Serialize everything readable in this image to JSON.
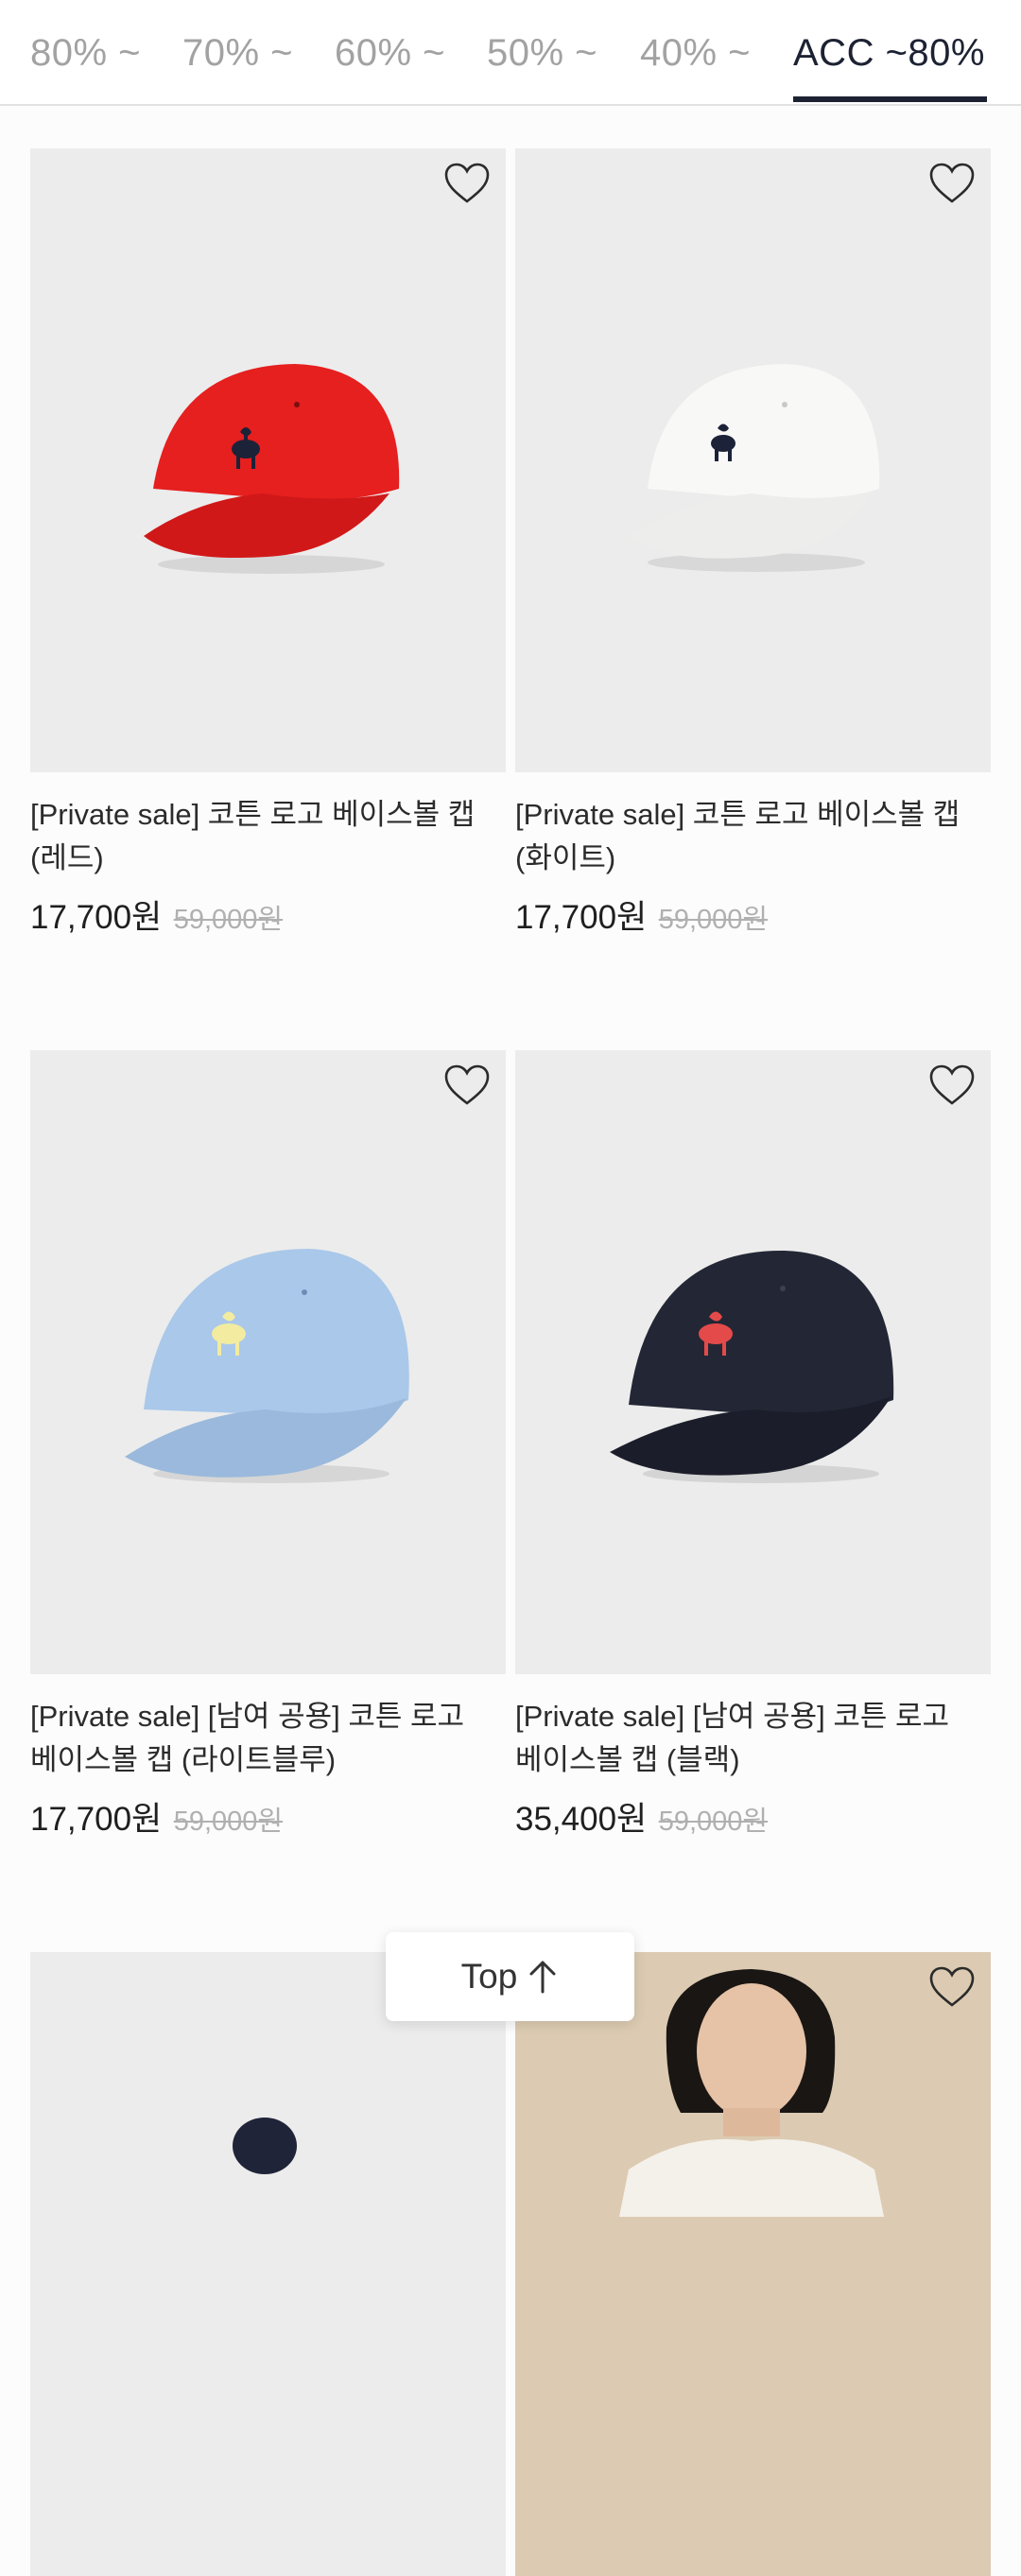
{
  "tabs": [
    {
      "label": "80% ~",
      "active": false
    },
    {
      "label": "70% ~",
      "active": false
    },
    {
      "label": "60% ~",
      "active": false
    },
    {
      "label": "50% ~",
      "active": false
    },
    {
      "label": "40% ~",
      "active": false
    },
    {
      "label": "ACC ~80%",
      "active": true
    }
  ],
  "products": [
    {
      "name_line1": "[Private sale] 코튼 로고 베이스볼 캡",
      "name_line2": "(레드)",
      "price": "17,700원",
      "original_price": "59,000원",
      "cap_color": "#e61f1f",
      "logo_color": "#1c2238"
    },
    {
      "name_line1": "[Private sale] 코튼 로고 베이스볼 캡",
      "name_line2": "(화이트)",
      "price": "17,700원",
      "original_price": "59,000원",
      "cap_color": "#f8f8f6",
      "logo_color": "#1c2238"
    },
    {
      "name_line1": "[Private sale] [남여 공용] 코튼 로고",
      "name_line2": "베이스볼 캡 (라이트블루)",
      "price": "17,700원",
      "original_price": "59,000원",
      "cap_color": "#a9c8ea",
      "logo_color": "#f2eba0"
    },
    {
      "name_line1": "[Private sale] [남여 공용] 코튼 로고",
      "name_line2": "베이스볼 캡 (블랙)",
      "price": "35,400원",
      "original_price": "59,000원",
      "cap_color": "#232735",
      "logo_color": "#e44a4a"
    }
  ],
  "top_button": {
    "label": "Top",
    "icon": "arrow-up-icon"
  },
  "colors": {
    "accent": "#1d2233",
    "inactive_tab": "#a2a2a2",
    "thumb_bg": "#ececec"
  }
}
